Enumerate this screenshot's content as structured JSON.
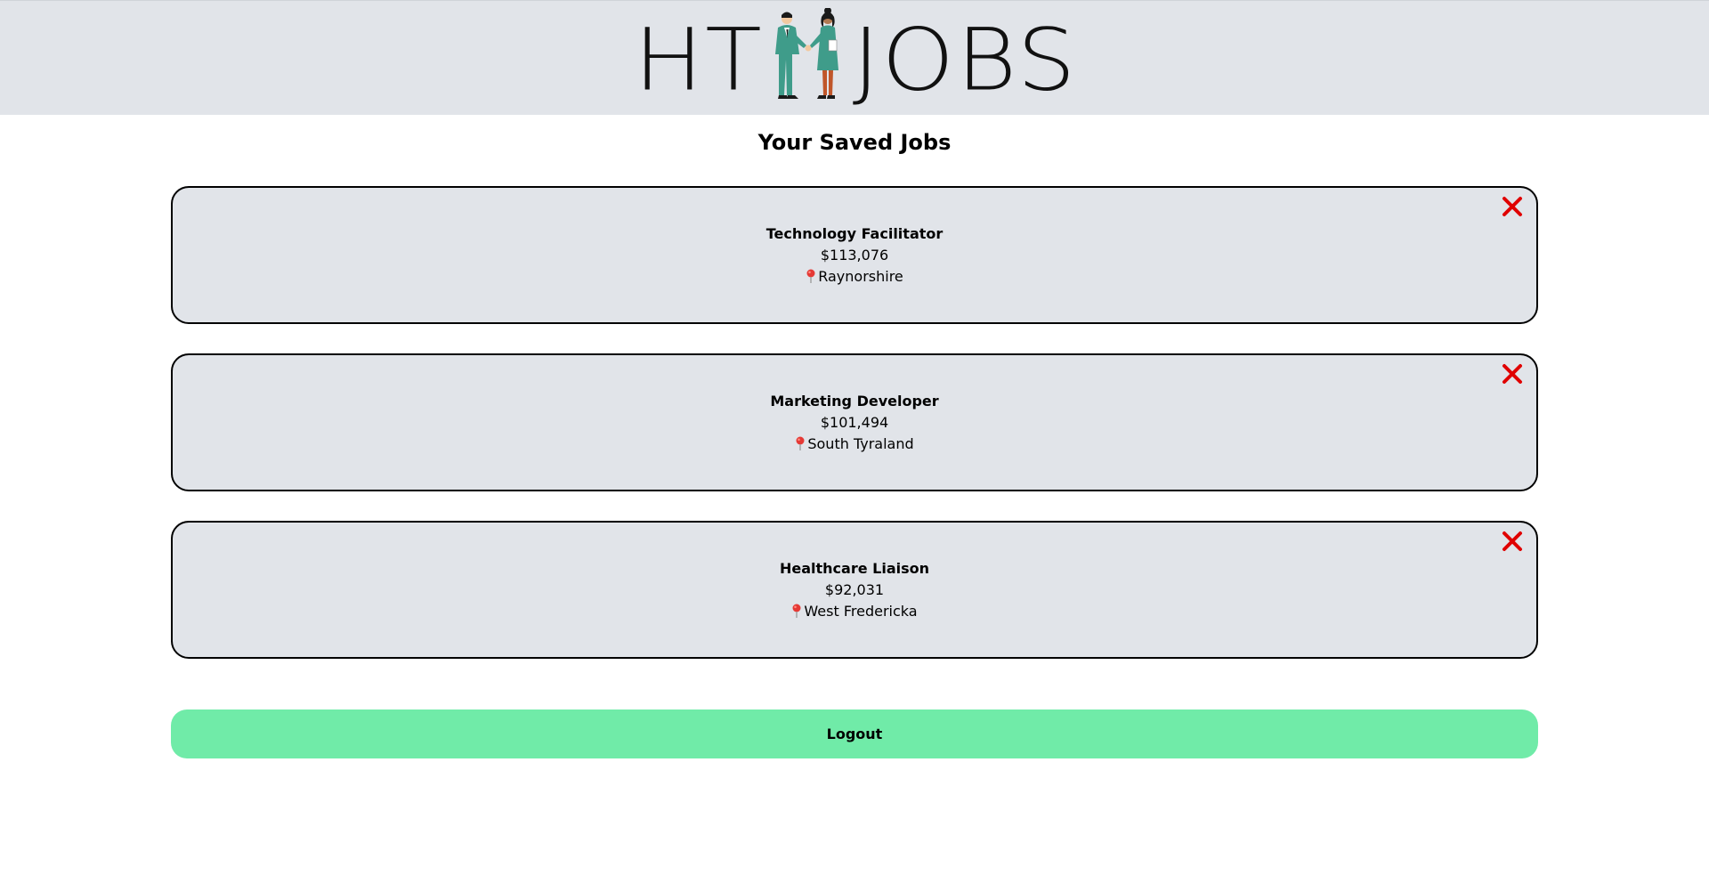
{
  "header": {
    "logo_left": "HT",
    "logo_right": "JOBS",
    "logo_figure_icon": "handshake-people-icon"
  },
  "page": {
    "title": "Your Saved Jobs"
  },
  "jobs": [
    {
      "title": "Technology Facilitator",
      "salary": "$113,076",
      "location": "Raynorshire"
    },
    {
      "title": "Marketing Developer",
      "salary": "$101,494",
      "location": "South Tyraland"
    },
    {
      "title": "Healthcare Liaison",
      "salary": "$92,031",
      "location": "West Fredericka"
    }
  ],
  "icons": {
    "remove": "close-icon",
    "location": "location-pin-icon"
  },
  "colors": {
    "header_bg": "#e1e4e9",
    "card_bg": "#e1e4e9",
    "remove_red": "#e00000",
    "logout_green": "#70eba8",
    "pin_red": "#e53935"
  },
  "actions": {
    "logout_label": "Logout"
  }
}
